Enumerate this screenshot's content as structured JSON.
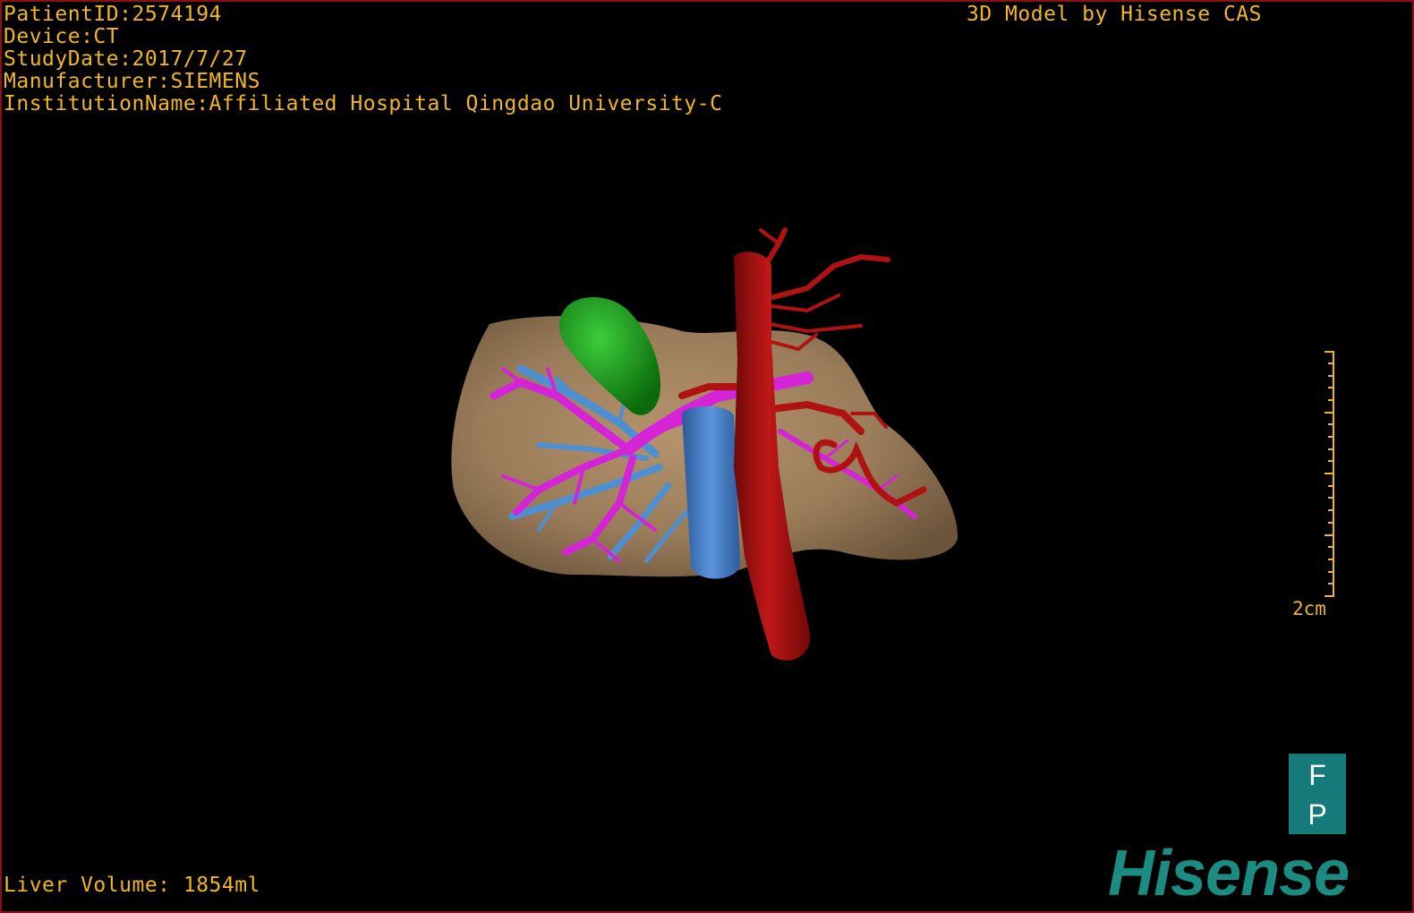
{
  "patient_info": {
    "patient_id": "PatientID:2574194",
    "device": "Device:CT",
    "study_date": "StudyDate:2017/7/27",
    "manufacturer": "Manufacturer:SIEMENS",
    "institution": "InstitutionName:Affiliated Hospital Qingdao University-C"
  },
  "credit": "3D Model by Hisense CAS",
  "liver_volume": "Liver Volume: 1854ml",
  "scale": {
    "label": "2cm"
  },
  "orientation": {
    "top": "F",
    "bottom": "P"
  },
  "brand": "Hisense",
  "colors": {
    "overlay_text": "#f0b623",
    "liver": "#9a7c5a",
    "gallbladder": "#1fa01f",
    "aorta": "#b01212",
    "vena_cava": "#4d84cc",
    "portal_vein": "#d524d8",
    "hepatic_vein": "#4e8fd2",
    "orientation_box": "#157a79",
    "brand": "#1a8c82",
    "frame": "#8a1111"
  }
}
